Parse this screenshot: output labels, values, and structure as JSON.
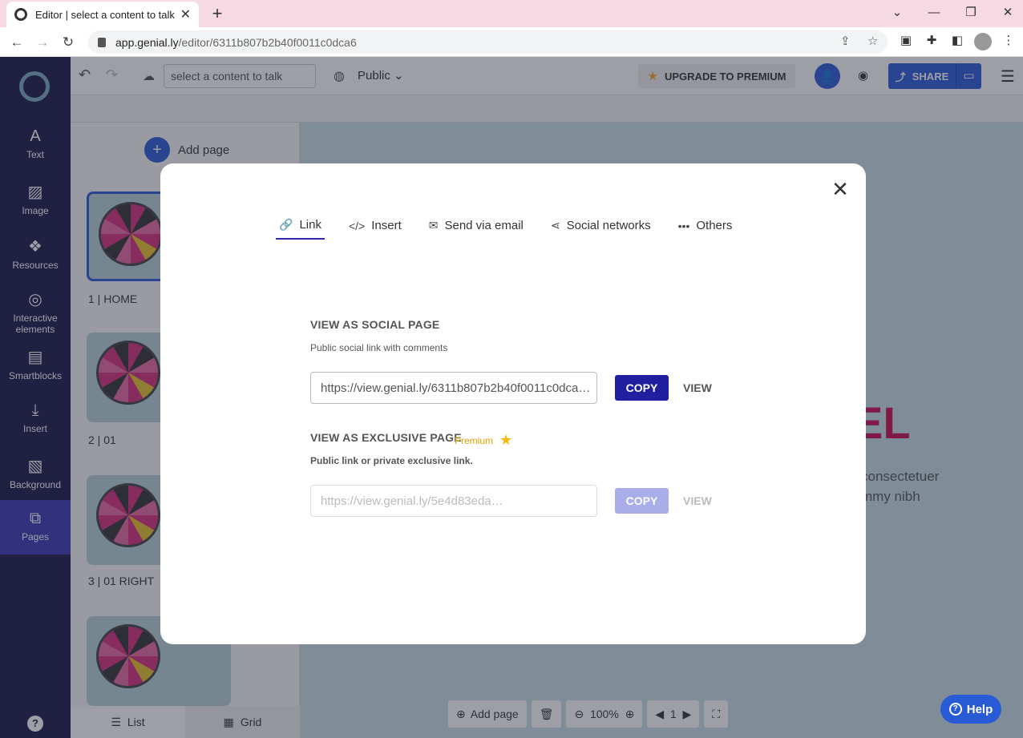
{
  "browser": {
    "tab_title": "Editor | select a content to talk",
    "url_host": "app.genial.ly",
    "url_path": "/editor/6311b807b2b40f0011c0dca6"
  },
  "toolbar": {
    "talk_placeholder": "select a content to talk",
    "visibility": "Public",
    "upgrade_label": "UPGRADE TO PREMIUM",
    "share_label": "SHARE"
  },
  "rail": {
    "items": [
      {
        "label": "Text",
        "icon": "text-icon"
      },
      {
        "label": "Image",
        "icon": "image-icon"
      },
      {
        "label": "Resources",
        "icon": "resources-icon"
      },
      {
        "label": "Interactive elements",
        "icon": "interactive-icon"
      },
      {
        "label": "Smartblocks",
        "icon": "smartblocks-icon"
      },
      {
        "label": "Insert",
        "icon": "insert-icon"
      },
      {
        "label": "Background",
        "icon": "background-icon"
      },
      {
        "label": "Pages",
        "icon": "pages-icon"
      }
    ]
  },
  "pages": {
    "add_label": "Add page",
    "items": [
      {
        "label": "1 |  HOME"
      },
      {
        "label": "2 |  01"
      },
      {
        "label": "3 |  01 RIGHT"
      }
    ],
    "list_label": "List",
    "grid_label": "Grid"
  },
  "canvas": {
    "title": "EL",
    "line1": "consectetuer",
    "line2": "mmy nibh",
    "zoom": "100%",
    "page_number": "1",
    "add_page": "Add page"
  },
  "help": {
    "label": "Help"
  },
  "modal": {
    "tabs": [
      {
        "label": "Link",
        "icon": "link-icon"
      },
      {
        "label": "Insert",
        "icon": "code-icon"
      },
      {
        "label": "Send via email",
        "icon": "email-icon"
      },
      {
        "label": "Social networks",
        "icon": "share-icon"
      },
      {
        "label": "Others",
        "icon": "more-icon"
      }
    ],
    "social": {
      "title": "VIEW AS SOCIAL PAGE",
      "subtitle": "Public social link with comments",
      "url": "https://view.genial.ly/6311b807b2b40f0011c0dca…",
      "copy": "COPY",
      "view": "VIEW"
    },
    "exclusive": {
      "title": "VIEW AS EXCLUSIVE PAGE",
      "badge": "Premium",
      "subtitle": "Public link or private exclusive link.",
      "url": "https://view.genial.ly/5e4d83eda…",
      "copy": "COPY",
      "view": "VIEW"
    }
  }
}
